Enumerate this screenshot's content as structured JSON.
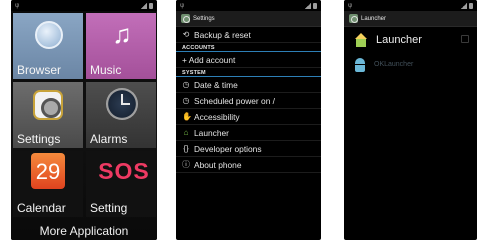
{
  "screen1": {
    "apps": [
      {
        "label": "Browser",
        "icon": "globe-icon"
      },
      {
        "label": "Music",
        "icon": "music-note-icon"
      },
      {
        "label": "Settings",
        "icon": "gear-icon"
      },
      {
        "label": "Alarms",
        "icon": "clock-icon"
      },
      {
        "label": "Calendar",
        "icon": "calendar-icon",
        "icon_text": "29"
      },
      {
        "label": "Setting",
        "icon": "sos-icon",
        "icon_text": "SOS"
      }
    ],
    "more_label": "More Application"
  },
  "screen2": {
    "title": "Settings",
    "rows_top": [
      {
        "label": "Backup & reset",
        "icon": "backup-icon"
      }
    ],
    "section_accounts": "ACCOUNTS",
    "add_account": "+ Add account",
    "section_system": "SYSTEM",
    "system_rows": [
      {
        "label": "Date & time",
        "icon": "clock-icon"
      },
      {
        "label": "Scheduled power on /",
        "icon": "power-icon"
      },
      {
        "label": "Accessibility",
        "icon": "hand-icon"
      },
      {
        "label": "Launcher",
        "icon": "home-icon"
      },
      {
        "label": "Developer options",
        "icon": "code-icon"
      },
      {
        "label": "About phone",
        "icon": "info-icon"
      }
    ]
  },
  "screen3": {
    "title": "Launcher",
    "options": [
      {
        "label": "Launcher",
        "icon": "home-icon",
        "dim": false
      },
      {
        "label": "OKLauncher",
        "icon": "android-icon",
        "dim": true
      }
    ]
  },
  "colors": {
    "section_divider": "#2d7fb6",
    "sos_red": "#ee3a63",
    "calendar_orange": "#e0431f"
  }
}
